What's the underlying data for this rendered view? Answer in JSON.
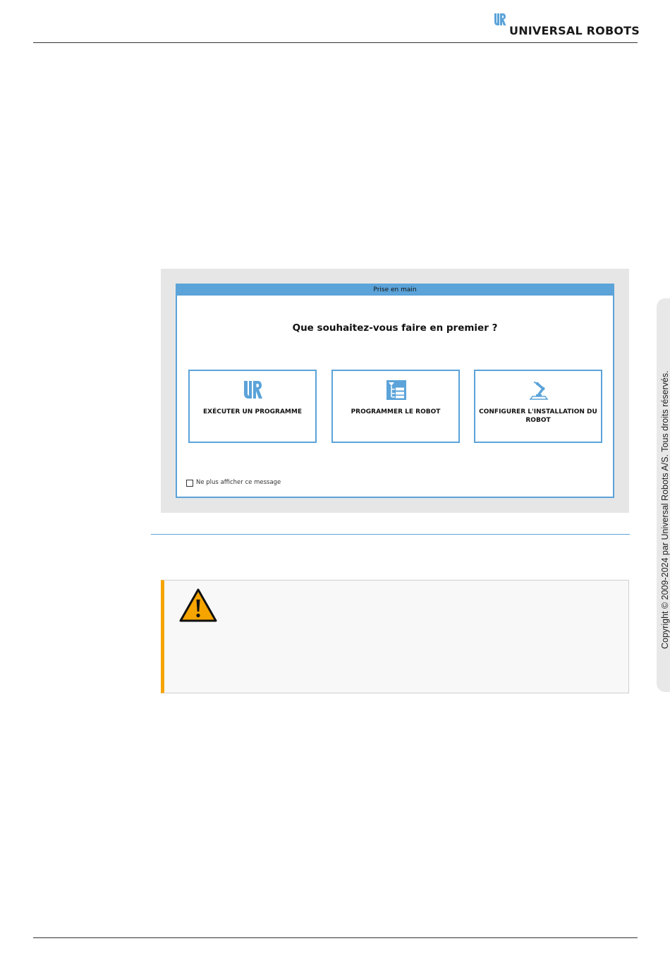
{
  "header": {
    "brand_name": "UNIVERSAL ROBOTS"
  },
  "side": {
    "copyright": "Copyright © 2009-2024 par Universal Robots A/S. Tous droits réservés."
  },
  "dialog": {
    "title": "Prise en main",
    "question": "Que souhaitez-vous faire en premier ?",
    "choices": [
      {
        "label": "EXÉCUTER UN PROGRAMME",
        "icon": "ur-logo-icon"
      },
      {
        "label": "PROGRAMMER LE ROBOT",
        "icon": "program-tree-icon"
      },
      {
        "label": "CONFIGURER L'INSTALLATION DU ROBOT",
        "icon": "robot-arm-icon"
      }
    ],
    "dont_show_label": "Ne plus afficher ce message"
  },
  "colors": {
    "accent_blue": "#5ba3d9",
    "warning_orange": "#f5a400",
    "figure_background": "#e6e6e6"
  },
  "warning": {
    "icon": "warning-triangle-icon"
  }
}
